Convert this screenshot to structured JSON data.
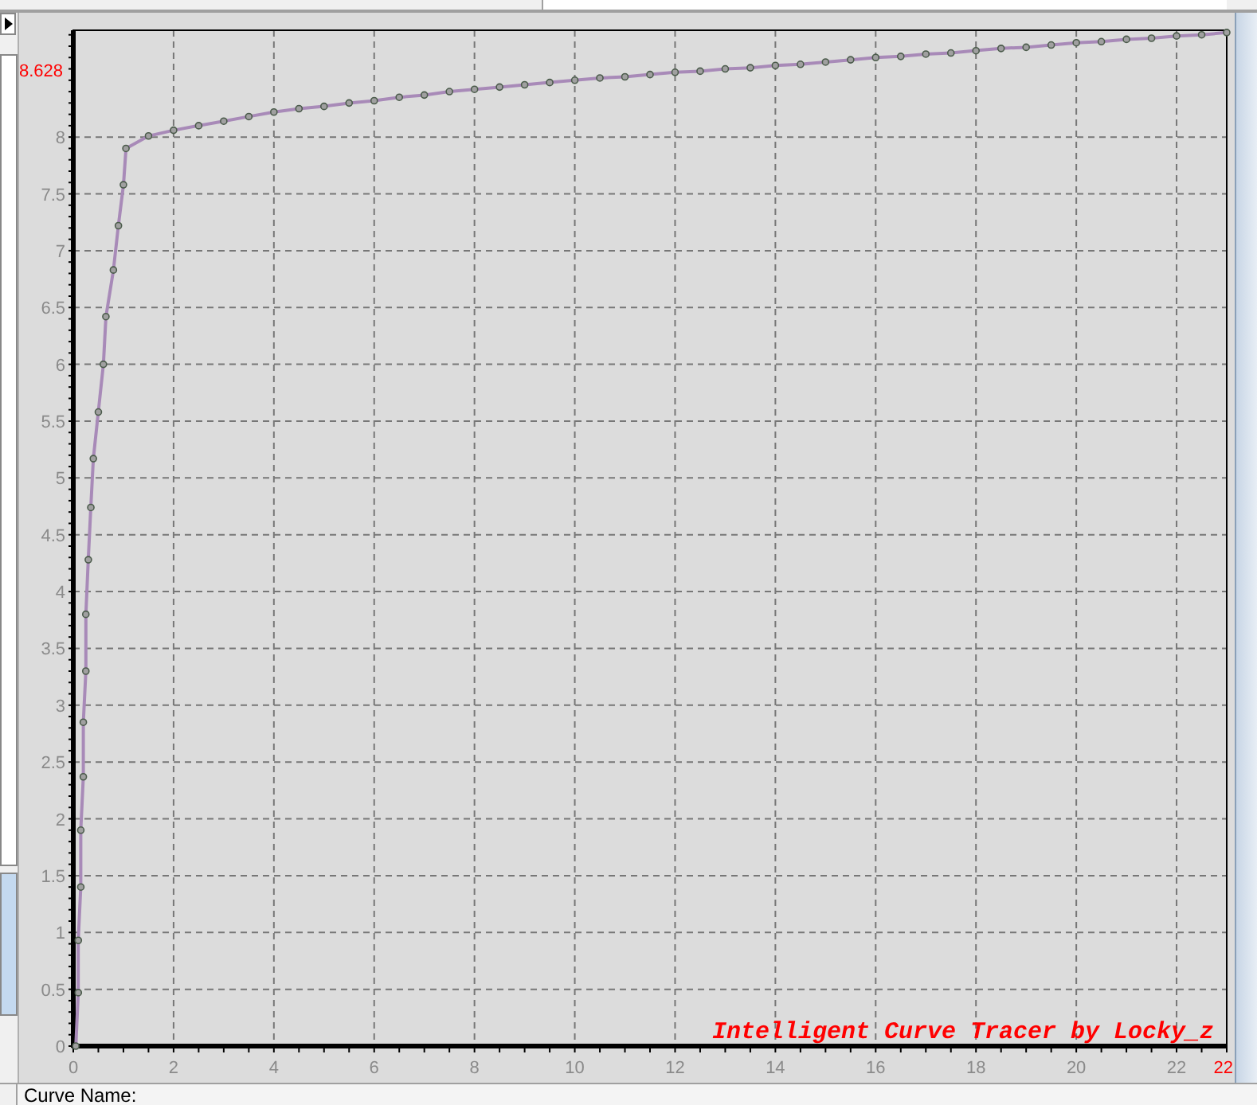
{
  "plot": {
    "chart_data": {
      "type": "line",
      "xlim": [
        0,
        23
      ],
      "ylim": [
        0,
        8.94
      ],
      "xticks": [
        0,
        2,
        4,
        6,
        8,
        10,
        12,
        14,
        16,
        18,
        20,
        22
      ],
      "yticks": [
        0,
        0.5,
        1,
        1.5,
        2,
        2.5,
        3,
        3.5,
        4,
        4.5,
        5,
        5.5,
        6,
        6.5,
        7,
        7.5,
        8
      ],
      "x": [
        0.05,
        0.1,
        0.1,
        0.15,
        0.15,
        0.2,
        0.2,
        0.25,
        0.25,
        0.3,
        0.35,
        0.4,
        0.5,
        0.6,
        0.65,
        0.8,
        0.9,
        1.0,
        1.05,
        1.5,
        2,
        2.5,
        3,
        3.5,
        4,
        4.5,
        5,
        5.5,
        6,
        6.5,
        7,
        7.5,
        8,
        8.5,
        9,
        9.5,
        10,
        10.5,
        11,
        11.5,
        12,
        12.5,
        13,
        13.5,
        14,
        14.5,
        15,
        15.5,
        16,
        16.5,
        17,
        17.5,
        18,
        18.5,
        19,
        19.5,
        20,
        20.5,
        21,
        21.5,
        22,
        22.5,
        23
      ],
      "grid": true,
      "series": [
        {
          "color": "#a88ab8",
          "marker": "circle",
          "values": [
            0,
            0.47,
            0.93,
            1.4,
            1.9,
            2.37,
            2.85,
            3.3,
            3.8,
            4.28,
            4.74,
            5.17,
            5.58,
            6.0,
            6.42,
            6.83,
            7.22,
            7.58,
            7.9,
            8.01,
            8.06,
            8.1,
            8.14,
            8.18,
            8.22,
            8.25,
            8.27,
            8.3,
            8.32,
            8.35,
            8.37,
            8.4,
            8.42,
            8.44,
            8.46,
            8.48,
            8.5,
            8.52,
            8.53,
            8.55,
            8.57,
            8.58,
            8.6,
            8.61,
            8.63,
            8.64,
            8.66,
            8.68,
            8.7,
            8.71,
            8.73,
            8.74,
            8.76,
            8.78,
            8.79,
            8.81,
            8.83,
            8.84,
            8.86,
            8.87,
            8.89,
            8.9,
            8.92
          ]
        }
      ],
      "annotations": [
        "8.628",
        "22"
      ]
    },
    "caption": "Intelligent Curve Tracer by Locky_z"
  },
  "curve_name": {
    "label": "Curve Name:"
  }
}
